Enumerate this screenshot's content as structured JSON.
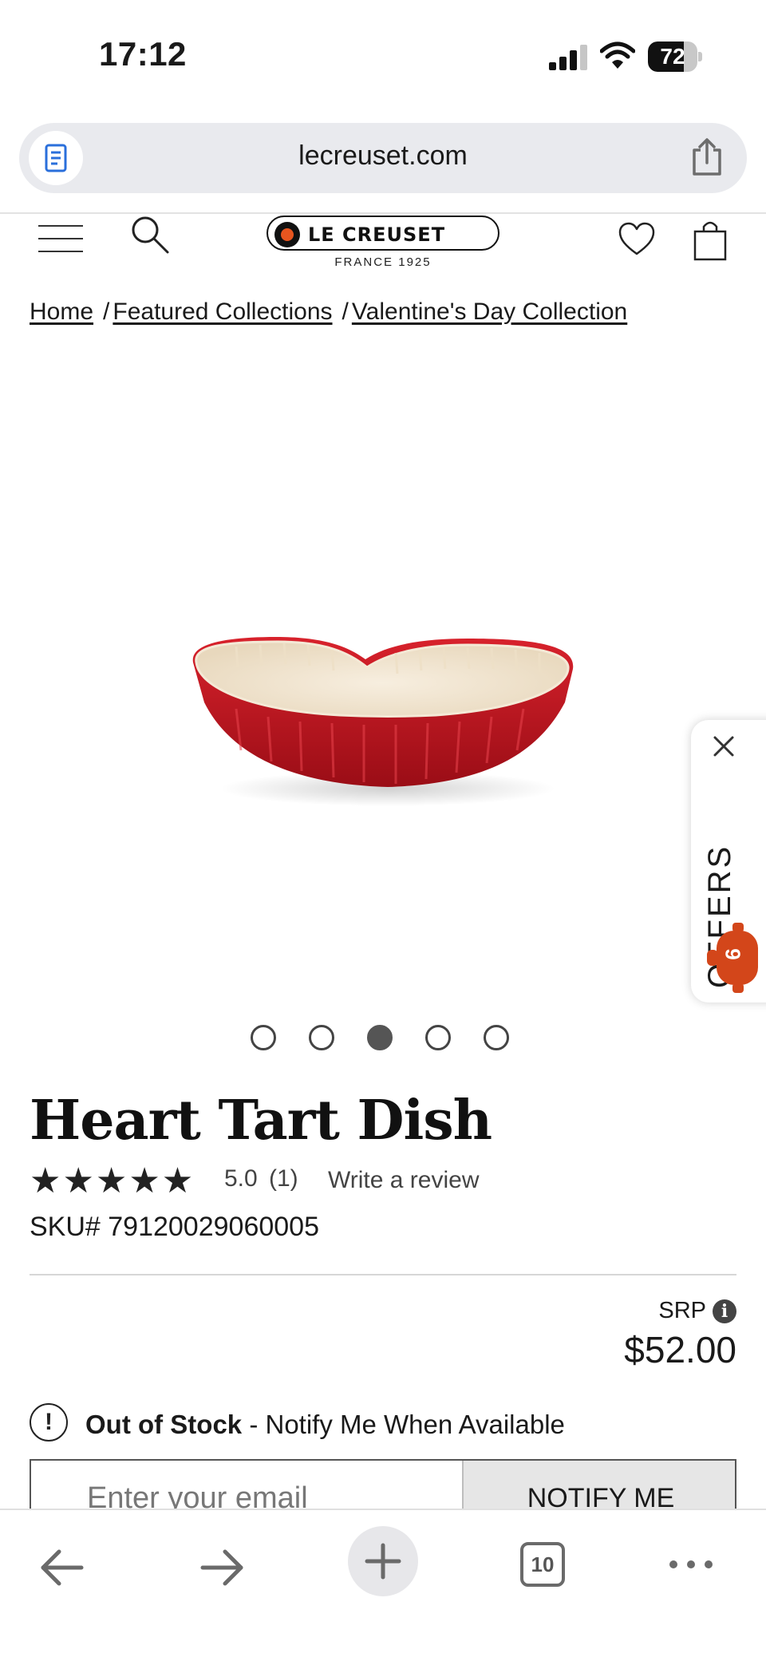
{
  "status_bar": {
    "time": "17:12",
    "battery_level": "72",
    "battery_fraction": 0.72
  },
  "browser": {
    "url": "lecreuset.com",
    "tab_count": "10"
  },
  "site_header": {
    "logo_name": "LE CREUSET",
    "logo_sub": "FRANCE 1925"
  },
  "breadcrumb": {
    "items": [
      "Home",
      "Featured Collections",
      "Valentine's Day Collection"
    ],
    "separator": "/"
  },
  "offers": {
    "label": "OFFERS",
    "count": "9"
  },
  "carousel": {
    "total": 5,
    "active_index": 2
  },
  "product": {
    "title": "Heart Tart Dish",
    "stars": "★★★★★",
    "rating": "5.0",
    "review_count": "(1)",
    "write_review": "Write a review",
    "sku": "SKU# 79120029060005",
    "srp_label": "SRP",
    "price": "$52.00",
    "stock_status": "Out of Stock",
    "stock_message": " - Notify Me When Available",
    "email_placeholder": "Enter your email",
    "notify_button": "NOTIFY ME"
  },
  "colors": {
    "accent_orange": "#e8551f",
    "dish_red": "#c8141f",
    "dish_cream": "#f3e7d3"
  }
}
